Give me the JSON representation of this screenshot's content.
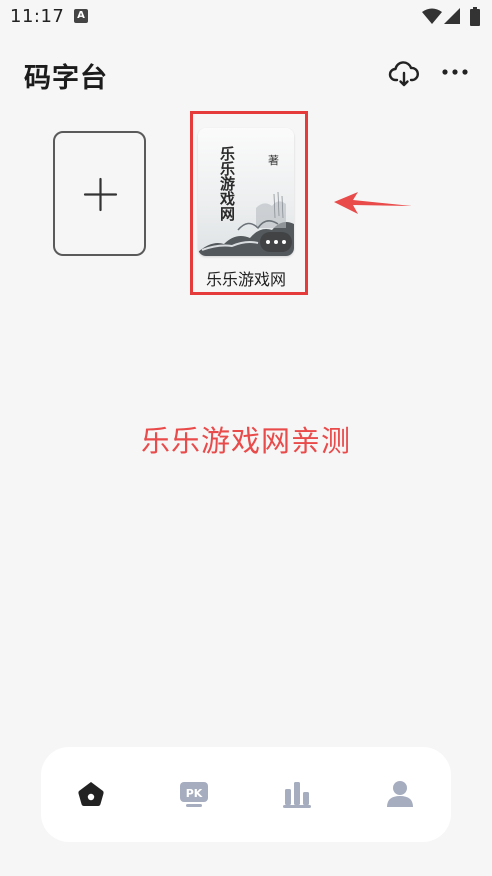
{
  "status_bar": {
    "time": "11:17",
    "notification_icon": "A"
  },
  "header": {
    "title": "码字台",
    "cloud_icon": "cloud-sync-icon",
    "more_icon": "more-horizontal-icon"
  },
  "books": [
    {
      "cover_title": "乐乐游戏网",
      "cover_author": "著",
      "name": "乐乐游戏网"
    }
  ],
  "add_book": {
    "icon": "plus-icon"
  },
  "watermark": "乐乐游戏网亲测",
  "colors": {
    "highlight": "#e53b3b",
    "watermark": "#e94a4a",
    "nav_active": "#222222",
    "nav_inactive": "#a6adbf"
  },
  "bottom_nav": {
    "items": [
      {
        "icon": "home-icon",
        "active": true
      },
      {
        "icon": "pk-icon",
        "active": false
      },
      {
        "icon": "bar-chart-icon",
        "active": false
      },
      {
        "icon": "profile-icon",
        "active": false
      }
    ]
  }
}
